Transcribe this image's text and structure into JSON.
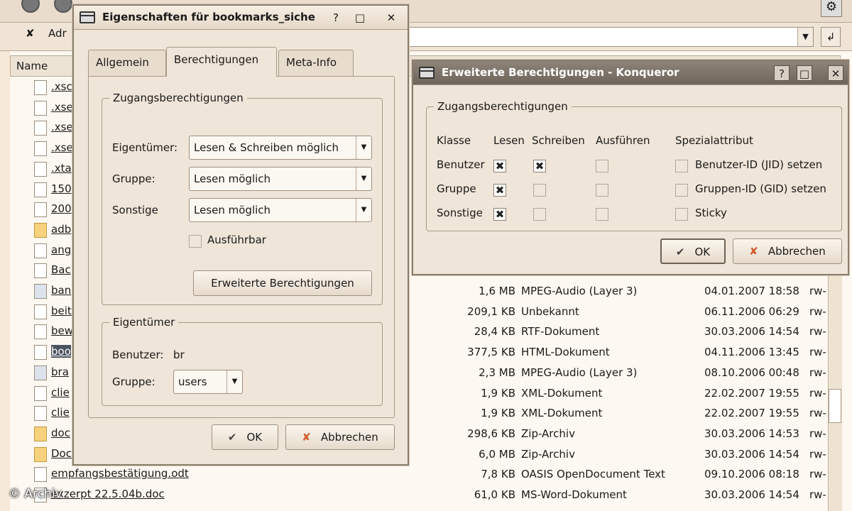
{
  "background": {
    "toolbar_hint": "Adr",
    "column_header": "Name",
    "files": [
      {
        "name": ".xsc",
        "size": "",
        "type": "",
        "date": "",
        "perm": "",
        "icon": "file-icon"
      },
      {
        "name": ".xse",
        "size": "",
        "type": "",
        "date": "",
        "perm": "",
        "icon": "file-icon"
      },
      {
        "name": ".xse",
        "size": "",
        "type": "",
        "date": "",
        "perm": "",
        "icon": "file-icon"
      },
      {
        "name": ".xse",
        "size": "",
        "type": "",
        "date": "",
        "perm": "",
        "icon": "file-icon"
      },
      {
        "name": ".xta",
        "size": "",
        "type": "",
        "date": "",
        "perm": "",
        "icon": "file-icon"
      },
      {
        "name": "150",
        "size": "",
        "type": "",
        "date": "",
        "perm": "",
        "icon": "image-file-icon"
      },
      {
        "name": "200",
        "size": "",
        "type": "",
        "date": "",
        "perm": "",
        "icon": "image-file-icon"
      },
      {
        "name": "adb",
        "size": "",
        "type": "",
        "date": "",
        "perm": "",
        "icon": "folder-icon"
      },
      {
        "name": "ang",
        "size": "",
        "type": "",
        "date": "",
        "perm": "",
        "icon": "image-file-icon"
      },
      {
        "name": "Bac",
        "size": "",
        "type": "",
        "date": "",
        "perm": "",
        "icon": "file-icon"
      },
      {
        "name": "ban",
        "size": "1,6 MB",
        "type": "MPEG-Audio (Layer 3)",
        "date": "04.01.2007 18:58",
        "perm": "rw-",
        "icon": "audio-file-icon"
      },
      {
        "name": "beit",
        "size": "209,1 KB",
        "type": "Unbekannt",
        "date": "06.11.2006 06:29",
        "perm": "rw-",
        "icon": "file-icon"
      },
      {
        "name": "bew",
        "size": "28,4 KB",
        "type": "RTF-Dokument",
        "date": "30.03.2006 14:54",
        "perm": "rw-",
        "icon": "file-icon"
      },
      {
        "name": "boo",
        "size": "377,5 KB",
        "type": "HTML-Dokument",
        "date": "04.11.2006 13:45",
        "perm": "rw-",
        "icon": "html-file-icon",
        "selected": true
      },
      {
        "name": "bra",
        "size": "2,3 MB",
        "type": "MPEG-Audio (Layer 3)",
        "date": "08.10.2006 00:48",
        "perm": "rw-",
        "icon": "audio-file-icon"
      },
      {
        "name": "clie",
        "size": "1,9 KB",
        "type": "XML-Dokument",
        "date": "22.02.2007 19:55",
        "perm": "rw-",
        "icon": "xml-file-icon"
      },
      {
        "name": "clie",
        "size": "1,9 KB",
        "type": "XML-Dokument",
        "date": "22.02.2007 19:55",
        "perm": "rw-",
        "icon": "xml-file-icon"
      },
      {
        "name": "doc",
        "size": "298,6 KB",
        "type": "Zip-Archiv",
        "date": "30.03.2006 14:53",
        "perm": "rw-",
        "icon": "folder-icon"
      },
      {
        "name": "Doc",
        "size": "6,0 MB",
        "type": "Zip-Archiv",
        "date": "30.03.2006 14:54",
        "perm": "rw-",
        "icon": "folder-icon"
      },
      {
        "name": "empfangsbestätigung.odt",
        "size": "7,8 KB",
        "type": "OASIS OpenDocument Text",
        "date": "09.10.2006 08:18",
        "perm": "rw-",
        "icon": "file-icon"
      },
      {
        "name": "exzerpt 22.5.04b.doc",
        "size": "61,0 KB",
        "type": "MS-Word-Dokument",
        "date": "30.03.2006 14:54",
        "perm": "rw-",
        "icon": "file-icon"
      }
    ],
    "watermark": "© Archiv"
  },
  "props_dialog": {
    "title": "Eigenschaften für bookmarks_siche",
    "help": "?",
    "maximize": "□",
    "close": "✕",
    "tabs": [
      "Allgemein",
      "Berechtigungen",
      "Meta-Info"
    ],
    "access_group": "Zugangsberechtigungen",
    "owner_label": "Eigentümer:",
    "owner_value": "Lesen & Schreiben möglich",
    "group_label": "Gruppe:",
    "group_value": "Lesen möglich",
    "others_label": "Sonstige",
    "others_value": "Lesen möglich",
    "executable_label": "Ausführbar",
    "advanced_button": "Erweiterte Berechtigungen",
    "owner_group": "Eigentümer",
    "user_label": "Benutzer:",
    "user_value": "br",
    "group2_label": "Gruppe:",
    "group2_value": "users",
    "ok": "OK",
    "cancel": "Abbrechen"
  },
  "adv_dialog": {
    "title": "Erweiterte Berechtigungen - Konqueror",
    "help": "?",
    "maximize": "□",
    "close": "✕",
    "group": "Zugangsberechtigungen",
    "headers": [
      "Klasse",
      "Lesen",
      "Schreiben",
      "Ausführen",
      "Spezialattribut"
    ],
    "rows": [
      {
        "label": "Benutzer",
        "read": true,
        "write": true,
        "exec": false,
        "special": "Benutzer-ID (JID) setzen"
      },
      {
        "label": "Gruppe",
        "read": true,
        "write": false,
        "exec": false,
        "special": "Gruppen-ID (GID) setzen"
      },
      {
        "label": "Sonstige",
        "read": true,
        "write": false,
        "exec": false,
        "special": "Sticky"
      }
    ],
    "ok": "OK",
    "cancel": "Abbrechen"
  }
}
